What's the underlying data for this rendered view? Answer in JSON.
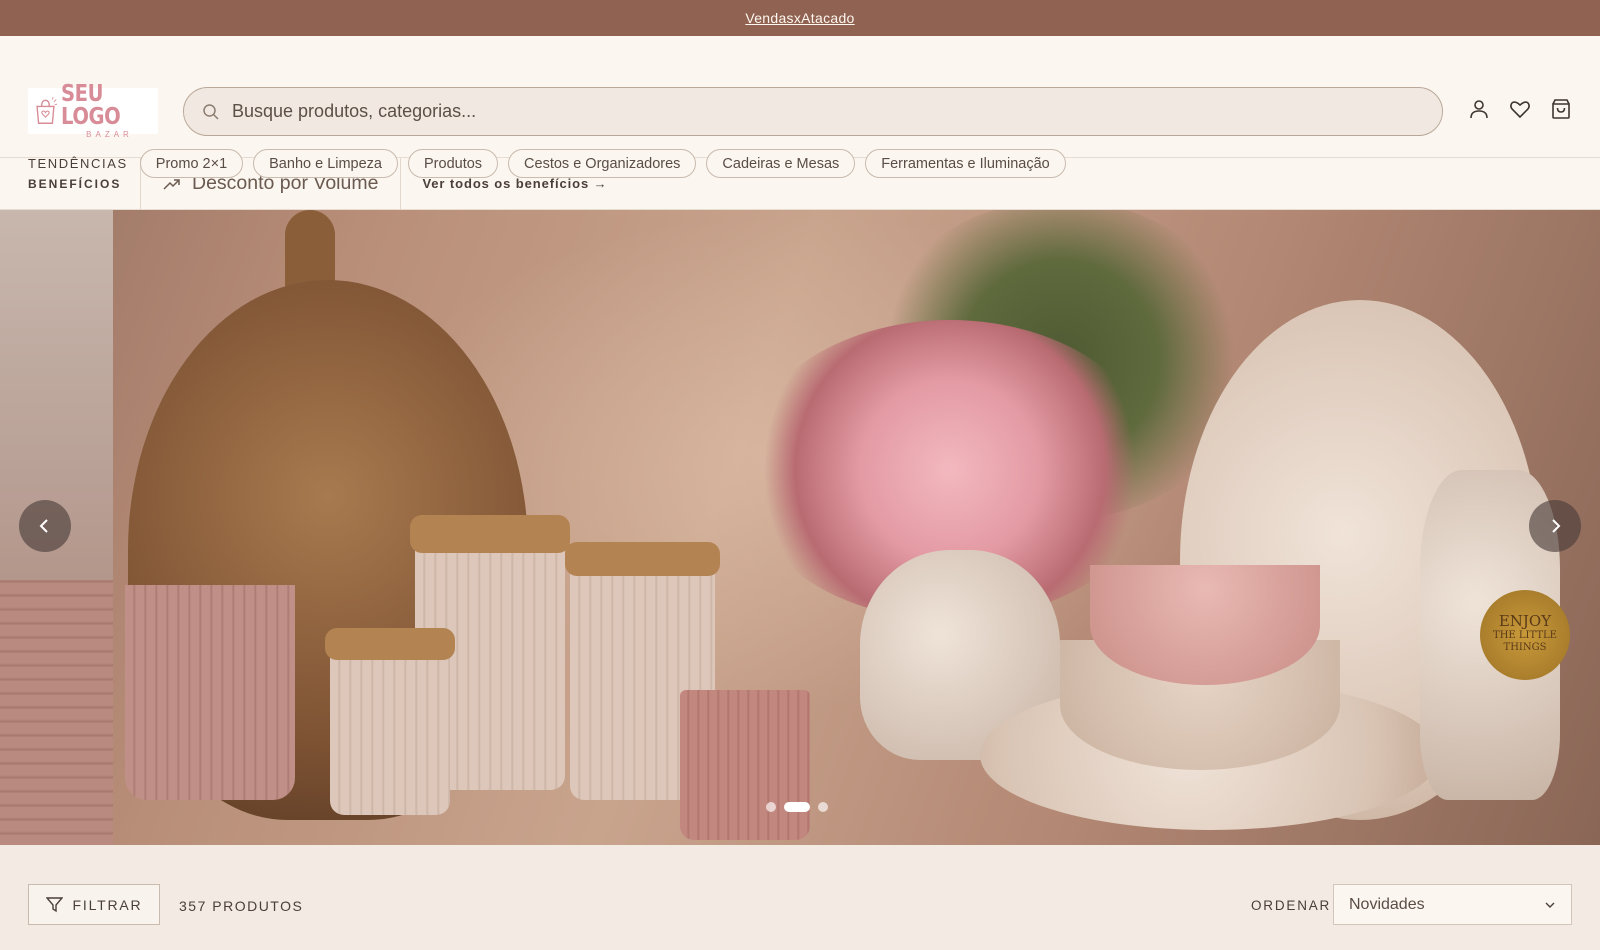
{
  "topbar": {
    "link_label": "VendasxAtacado"
  },
  "logo": {
    "main": "SEU LOGO",
    "sub": "BAZAR"
  },
  "search": {
    "placeholder": "Busque produtos, categorias..."
  },
  "header_icons": [
    "user-icon",
    "heart-icon",
    "bag-icon"
  ],
  "trends": {
    "label": "TENDÊNCIAS",
    "items": [
      "Promo 2×1",
      "Banho e Limpeza",
      "Produtos",
      "Cestos e Organizadores",
      "Cadeiras e Mesas",
      "Ferramentas e Iluminação"
    ]
  },
  "benefits": {
    "label": "BENEFÍCIOS",
    "item": "Desconto por Volume",
    "link": "Ver todos os benefícios →"
  },
  "hero": {
    "badge_line1": "ENJOY",
    "badge_line2": "THE LITTLE",
    "badge_line3": "THINGS",
    "slides_total": 3,
    "active_slide": 2
  },
  "toolbar": {
    "filter_label": "FILTRAR",
    "count": "357 PRODUTOS",
    "order_label": "ORDENAR",
    "order_value": "Novidades"
  },
  "colors": {
    "topbar": "#8f6252",
    "header_bg": "#fbf6f0",
    "page_bg": "#f3ebe3",
    "accent_pink": "#d88c97"
  }
}
